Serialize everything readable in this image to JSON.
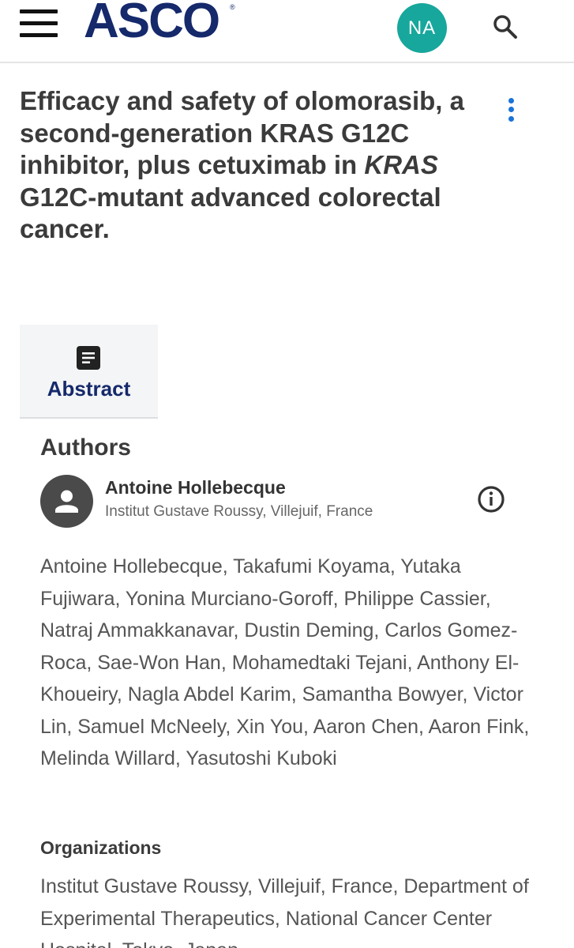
{
  "header": {
    "logo_text": "ASCO",
    "logo_mark": "®",
    "user_initials": "NA",
    "menu_icon": "hamburger-menu-icon",
    "search_icon": "search-icon",
    "brand_color": "#15296b",
    "avatar_color": "#17a79c"
  },
  "article": {
    "title_part1": "Efficacy and safety of olomorasib, a second-generation KRAS G12C inhibitor, plus cetuximab in ",
    "title_italic": "KRAS",
    "title_part2": " G12C-mutant advanced colorectal cancer.",
    "more_icon": "more-vertical-icon"
  },
  "tabs": [
    {
      "label": "Abstract",
      "icon": "document-icon"
    }
  ],
  "authors": {
    "heading": "Authors",
    "featured": {
      "name": "Antoine Hollebecque",
      "affiliation": "Institut Gustave Roussy, Villejuif, France",
      "icon": "person-icon",
      "info_icon": "info-icon"
    },
    "list": "Antoine Hollebecque, Takafumi Koyama, Yutaka Fujiwara, Yonina Murciano-Goroff, Philippe Cassier, Natraj Ammakkanavar, Dustin Deming, Carlos Gomez-Roca, Sae-Won Han, Mohamedtaki Tejani, Anthony El-Khoueiry, Nagla Abdel Karim, Samantha Bowyer, Victor Lin, Samuel McNeely, Xin You, Aaron Chen, Aaron Fink, Melinda Willard, Yasutoshi Kuboki"
  },
  "organizations": {
    "heading": "Organizations",
    "text": "Institut Gustave Roussy, Villejuif, France, Department of Experimental Therapeutics, National Cancer Center Hospital, Tokyo, Japan"
  }
}
